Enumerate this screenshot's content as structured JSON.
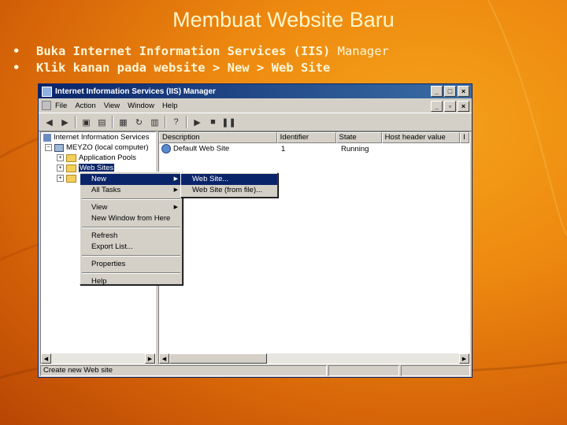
{
  "slide": {
    "title": "Membuat Website Baru",
    "bullets": [
      {
        "pre": "Buka Internet Information Services (IIS) ",
        "rest": "Manager"
      },
      {
        "pre": "Klik kanan pada website > New > Web Site",
        "rest": ""
      }
    ]
  },
  "window": {
    "title": "Internet Information Services (IIS) Manager",
    "menu": [
      "File",
      "Action",
      "View",
      "Window",
      "Help"
    ],
    "toolbar_icons": [
      "back-arrow-icon",
      "forward-arrow-icon",
      "up-folder-icon",
      "console-icon",
      "properties-icon",
      "refresh-icon",
      "export-icon",
      "help-icon",
      "play-icon",
      "stop-icon",
      "pause-icon"
    ],
    "tree": {
      "root": "Internet Information Services",
      "computer": "MEYZO (local computer)",
      "app_pools": "Application Pools",
      "web_sites": "Web Sites"
    },
    "columns": [
      "Description",
      "Identifier",
      "State",
      "Host header value",
      "I"
    ],
    "rows": [
      {
        "description": "Default Web Site",
        "identifier": "1",
        "state": "Running",
        "host": ""
      }
    ],
    "status": "Create new Web site"
  },
  "context_menu": {
    "items": [
      "New",
      "All Tasks",
      "View",
      "New Window from Here",
      "Refresh",
      "Export List...",
      "Properties",
      "Help"
    ]
  },
  "submenu": {
    "items": [
      "Web Site...",
      "Web Site (from file)..."
    ]
  },
  "colors": {
    "selection": "#0a246a",
    "title_text": "#fff6c8"
  }
}
